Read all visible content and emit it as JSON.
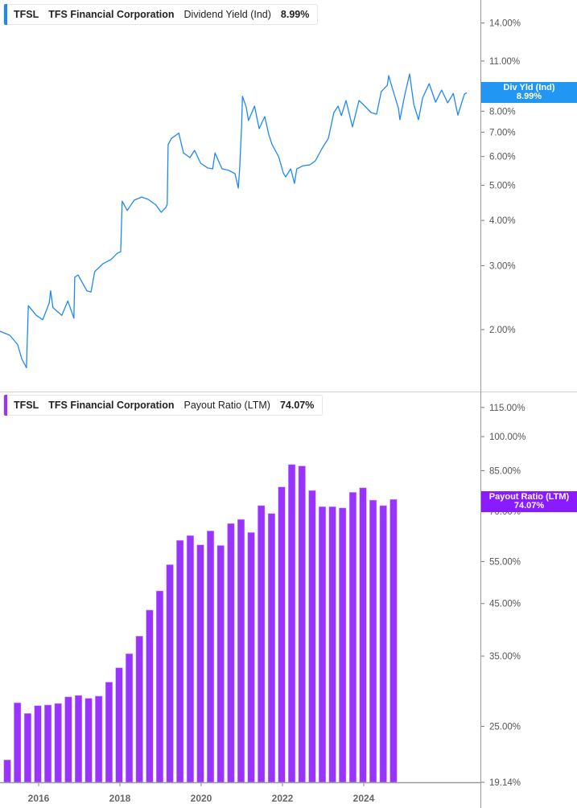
{
  "colors": {
    "yield_line": "#1e88f5",
    "yield_badge": "#2196f3",
    "payout_bar": "#9933ff",
    "payout_badge": "#8a1aff"
  },
  "top_legend": {
    "ticker": "TFSL",
    "company": "TFS Financial Corporation",
    "metric": "Dividend Yield (Ind)",
    "value": "8.99%"
  },
  "top_badge": {
    "label": "Div Yld (Ind)",
    "value": "8.99%"
  },
  "bottom_legend": {
    "ticker": "TFSL",
    "company": "TFS Financial Corporation",
    "metric": "Payout Ratio (LTM)",
    "value": "74.07%"
  },
  "bottom_badge": {
    "label": "Payout Ratio (LTM)",
    "value": "74.07%"
  },
  "chart_data": [
    {
      "type": "line",
      "series_label": "Dividend Yield (Ind)",
      "y_scale": "log",
      "y_ticks": [
        "2.00%",
        "3.00%",
        "4.00%",
        "5.00%",
        "6.00%",
        "7.00%",
        "8.00%",
        "11.00%",
        "14.00%"
      ],
      "y_tick_values": [
        2,
        3,
        4,
        5,
        6,
        7,
        8,
        11,
        14
      ],
      "xlim": [
        2015.0,
        2025.05
      ],
      "points": [
        [
          2015.0,
          1.98
        ],
        [
          2015.21,
          1.93
        ],
        [
          2015.38,
          1.82
        ],
        [
          2015.47,
          1.66
        ],
        [
          2015.57,
          1.57
        ],
        [
          2015.61,
          2.33
        ],
        [
          2015.78,
          2.19
        ],
        [
          2015.92,
          2.13
        ],
        [
          2016.06,
          2.37
        ],
        [
          2016.09,
          2.56
        ],
        [
          2016.14,
          2.3
        ],
        [
          2016.33,
          2.19
        ],
        [
          2016.46,
          2.4
        ],
        [
          2016.59,
          2.15
        ],
        [
          2016.61,
          2.79
        ],
        [
          2016.68,
          2.83
        ],
        [
          2016.87,
          2.56
        ],
        [
          2016.96,
          2.54
        ],
        [
          2017.04,
          2.89
        ],
        [
          2017.22,
          3.04
        ],
        [
          2017.39,
          3.12
        ],
        [
          2017.53,
          3.25
        ],
        [
          2017.6,
          3.28
        ],
        [
          2017.63,
          4.52
        ],
        [
          2017.74,
          4.26
        ],
        [
          2017.89,
          4.55
        ],
        [
          2018.05,
          4.64
        ],
        [
          2018.19,
          4.57
        ],
        [
          2018.36,
          4.41
        ],
        [
          2018.47,
          4.21
        ],
        [
          2018.57,
          4.34
        ],
        [
          2018.6,
          4.43
        ],
        [
          2018.62,
          6.47
        ],
        [
          2018.69,
          6.73
        ],
        [
          2018.85,
          6.96
        ],
        [
          2018.95,
          6.14
        ],
        [
          2019.09,
          5.96
        ],
        [
          2019.19,
          6.24
        ],
        [
          2019.32,
          5.75
        ],
        [
          2019.47,
          5.58
        ],
        [
          2019.58,
          5.55
        ],
        [
          2019.63,
          6.14
        ],
        [
          2019.78,
          5.55
        ],
        [
          2019.92,
          5.5
        ],
        [
          2020.06,
          5.38
        ],
        [
          2020.13,
          4.91
        ],
        [
          2020.16,
          5.55
        ],
        [
          2020.2,
          7.16
        ],
        [
          2020.22,
          8.79
        ],
        [
          2020.3,
          8.22
        ],
        [
          2020.35,
          7.54
        ],
        [
          2020.48,
          8.26
        ],
        [
          2020.58,
          7.16
        ],
        [
          2020.7,
          7.73
        ],
        [
          2020.79,
          6.88
        ],
        [
          2020.86,
          6.47
        ],
        [
          2021.0,
          5.99
        ],
        [
          2021.1,
          5.41
        ],
        [
          2021.15,
          5.27
        ],
        [
          2021.26,
          5.55
        ],
        [
          2021.34,
          5.06
        ],
        [
          2021.39,
          5.55
        ],
        [
          2021.53,
          5.66
        ],
        [
          2021.67,
          5.69
        ],
        [
          2021.79,
          5.84
        ],
        [
          2021.93,
          6.3
        ],
        [
          2022.07,
          6.73
        ],
        [
          2022.19,
          7.93
        ],
        [
          2022.28,
          8.26
        ],
        [
          2022.35,
          7.78
        ],
        [
          2022.45,
          8.56
        ],
        [
          2022.59,
          7.24
        ],
        [
          2022.73,
          8.56
        ],
        [
          2022.82,
          8.35
        ],
        [
          2022.99,
          7.93
        ],
        [
          2023.11,
          7.85
        ],
        [
          2023.21,
          9.06
        ],
        [
          2023.34,
          9.43
        ],
        [
          2023.37,
          10.03
        ],
        [
          2023.46,
          9.15
        ],
        [
          2023.58,
          8.13
        ],
        [
          2023.61,
          7.58
        ],
        [
          2023.72,
          8.92
        ],
        [
          2023.82,
          10.13
        ],
        [
          2023.91,
          8.35
        ],
        [
          2024.01,
          7.58
        ],
        [
          2024.1,
          8.7
        ],
        [
          2024.24,
          9.53
        ],
        [
          2024.38,
          8.47
        ],
        [
          2024.51,
          9.15
        ],
        [
          2024.64,
          8.43
        ],
        [
          2024.76,
          8.95
        ],
        [
          2024.86,
          7.8
        ],
        [
          2025.0,
          8.92
        ],
        [
          2025.05,
          8.99
        ]
      ]
    },
    {
      "type": "bar",
      "series_label": "Payout Ratio (LTM)",
      "y_scale": "log",
      "ylim": [
        19.14,
        125
      ],
      "y_ticks": [
        "19.14%",
        "25.00%",
        "35.00%",
        "45.00%",
        "55.00%",
        "70.00%",
        "85.00%",
        "100.00%",
        "115.00%"
      ],
      "y_tick_values": [
        19.14,
        25,
        35,
        45,
        55,
        70,
        85,
        100,
        115
      ],
      "x_ticks": [
        "2016",
        "2018",
        "2020",
        "2022",
        "2024"
      ],
      "x_tick_values": [
        2016,
        2018,
        2020,
        2022,
        2024
      ],
      "xlim": [
        2015.05,
        2025.0
      ],
      "x": [
        2015.23,
        2015.48,
        2015.73,
        2015.98,
        2016.23,
        2016.48,
        2016.73,
        2016.98,
        2017.23,
        2017.48,
        2017.73,
        2017.98,
        2018.23,
        2018.48,
        2018.73,
        2018.98,
        2019.23,
        2019.48,
        2019.73,
        2019.98,
        2020.23,
        2020.48,
        2020.73,
        2020.98,
        2021.23,
        2021.48,
        2021.73,
        2021.98,
        2022.23,
        2022.48,
        2022.73,
        2022.98,
        2023.23,
        2023.48,
        2023.73,
        2023.98,
        2024.23,
        2024.48,
        2024.73
      ],
      "values": [
        21.3,
        28.0,
        26.6,
        27.6,
        27.7,
        27.9,
        28.8,
        29.0,
        28.6,
        28.9,
        30.9,
        33.1,
        35.4,
        38.5,
        43.6,
        47.8,
        54.2,
        60.9,
        62.3,
        59.6,
        63.7,
        59.4,
        66.0,
        67.3,
        63.2,
        71.9,
        69.2,
        78.6,
        87.5,
        86.9,
        77.3,
        71.5,
        71.5,
        71.1,
        76.6,
        78.3,
        73.8,
        71.9,
        74.07
      ]
    }
  ]
}
